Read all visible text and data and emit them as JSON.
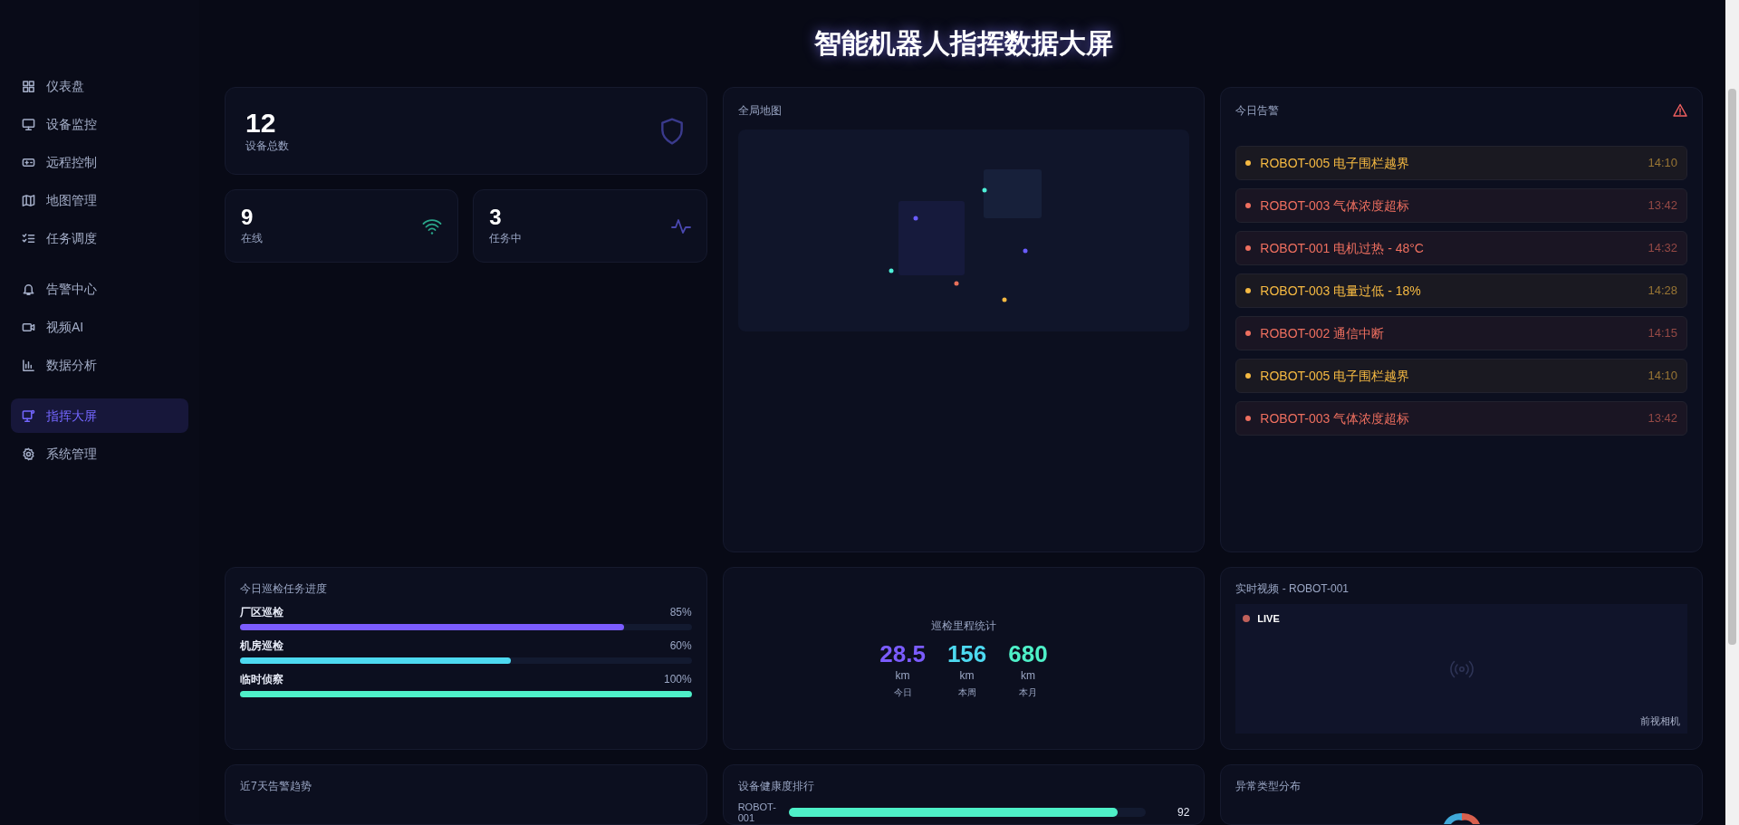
{
  "sidebar": {
    "groups": [
      {
        "items": [
          {
            "label": "仪表盘",
            "selected": false
          },
          {
            "label": "设备监控",
            "selected": false
          },
          {
            "label": "远程控制",
            "selected": false
          },
          {
            "label": "地图管理",
            "selected": false
          },
          {
            "label": "任务调度",
            "selected": false
          }
        ]
      },
      {
        "items": [
          {
            "label": "告警中心",
            "selected": false
          },
          {
            "label": "视频AI",
            "selected": false
          },
          {
            "label": "数据分析",
            "selected": false
          }
        ]
      },
      {
        "items": [
          {
            "label": "指挥大屏",
            "selected": true
          },
          {
            "label": "系统管理",
            "selected": false
          }
        ]
      }
    ]
  },
  "title": "智能机器人指挥数据大屏",
  "stats": [
    {
      "value": "12",
      "label": "设备总数"
    },
    {
      "value": "9",
      "label": "在线"
    },
    {
      "value": "3",
      "label": "任务中"
    }
  ],
  "map": {
    "title": "全局地图",
    "pins": [
      {
        "color": "#4ef0d8"
      },
      {
        "color": "#6a5cff"
      },
      {
        "color": "#6a5cff"
      },
      {
        "color": "#4ef0d8"
      },
      {
        "color": "#e8705a"
      },
      {
        "color": "#f5b942"
      }
    ]
  },
  "alerts": {
    "title": "今日告警",
    "items": [
      {
        "text": "ROBOT-005 电子围栏越界",
        "time": "14:10",
        "color": "#f5b942"
      },
      {
        "text": "ROBOT-003 气体浓度超标",
        "time": "13:42",
        "color": "#ee6f5f"
      },
      {
        "text": "ROBOT-001 电机过热 - 48°C",
        "time": "14:32",
        "color": "#ee6f5f"
      },
      {
        "text": "ROBOT-003 电量过低 - 18%",
        "time": "14:28",
        "color": "#f5b942"
      },
      {
        "text": "ROBOT-002 通信中断",
        "time": "14:15",
        "color": "#ee6f5f"
      },
      {
        "text": "ROBOT-005 电子围栏越界",
        "time": "14:10",
        "color": "#f5b942"
      },
      {
        "text": "ROBOT-003 气体浓度超标",
        "time": "13:42",
        "color": "#ee6f5f"
      }
    ]
  },
  "tasks": {
    "title": "今日巡检任务进度",
    "items": [
      {
        "name": "厂区巡检",
        "percent": "85%",
        "level": 0.85,
        "color": "#7b5cff"
      },
      {
        "name": "机房巡检",
        "percent": "60%",
        "level": 0.6,
        "color": "#4dd9f0"
      },
      {
        "name": "临时侦察",
        "percent": "100%",
        "level": 1,
        "color": "#4ef0c8"
      }
    ]
  },
  "mileage": {
    "title": "巡检里程统计",
    "stats": [
      {
        "value": "28.5",
        "unit": "km",
        "label": "今日",
        "color": "#7b5cff"
      },
      {
        "value": "156",
        "unit": "km",
        "label": "本周",
        "color": "#4dd9f0"
      },
      {
        "value": "680",
        "unit": "km",
        "label": "本月",
        "color": "#4ef0c8"
      }
    ]
  },
  "video": {
    "title": "实时视频 - ROBOT-001",
    "badge": "LIVE",
    "camera": "前视相机"
  },
  "trend": {
    "title": "近7天告警趋势"
  },
  "health": {
    "title": "设备健康度排行",
    "items": [
      {
        "name": "ROBOT-001",
        "score": "92",
        "level": 0.92
      }
    ]
  },
  "anomaly": {
    "title": "异常类型分布"
  }
}
